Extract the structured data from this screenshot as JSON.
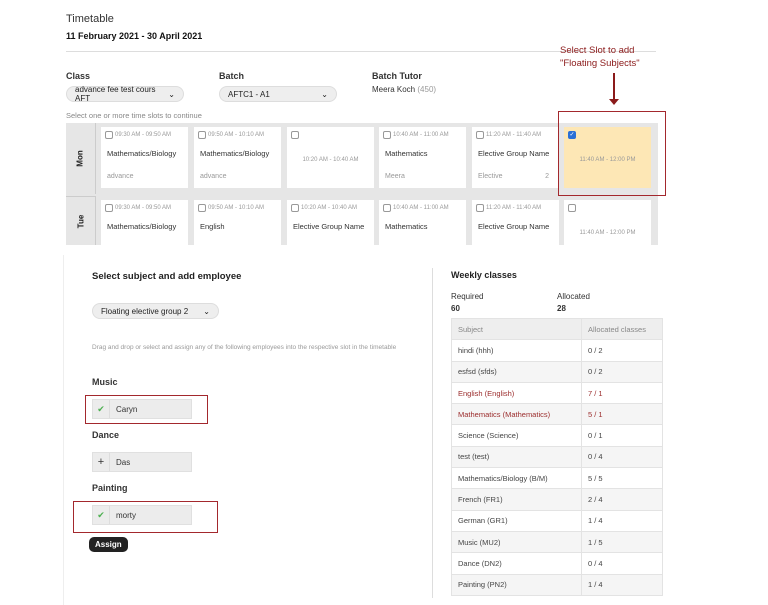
{
  "header": {
    "title": "Timetable",
    "dates": "11 February 2021 - 30 April 2021"
  },
  "filters": {
    "class_label": "Class",
    "class_value": "advance fee test cours AFT",
    "batch_label": "Batch",
    "batch_value": "AFTC1 - A1",
    "tutor_label": "Batch Tutor",
    "tutor_name": "Meera Koch",
    "tutor_count": "(450)",
    "hint": "Select one or more time slots to continue"
  },
  "annotation": {
    "line1": "Select Slot to add",
    "line2": "\"Floating Subjects\"",
    "color": "#8b1a1a"
  },
  "timetable": {
    "days": [
      {
        "day": "Mon",
        "slots": [
          {
            "time": "09:30 AM - 09:50 AM",
            "subject": "Mathematics/Biology",
            "employee": "advance",
            "checked": false
          },
          {
            "time": "09:50 AM - 10:10 AM",
            "subject": "Mathematics/Biology",
            "employee": "advance",
            "checked": false
          },
          {
            "time": "10:20 AM - 10:40 AM",
            "empty": true,
            "checked": false
          },
          {
            "time": "10:40 AM - 11:00 AM",
            "subject": "Mathematics",
            "employee": "Meera",
            "checked": false
          },
          {
            "time": "11:20 AM - 11:40 AM",
            "subject": "Elective Group Name",
            "employee": "Elective",
            "count": "2",
            "checked": false
          },
          {
            "time": "11:40 AM - 12:00 PM",
            "empty": true,
            "checked": true
          }
        ]
      },
      {
        "day": "Tue",
        "slots": [
          {
            "time": "09:30 AM - 09:50 AM",
            "subject": "Mathematics/Biology",
            "checked": false
          },
          {
            "time": "09:50 AM - 10:10 AM",
            "subject": "English",
            "checked": false
          },
          {
            "time": "10:20 AM - 10:40 AM",
            "subject": "Elective Group Name",
            "checked": false
          },
          {
            "time": "10:40 AM - 11:00 AM",
            "subject": "Mathematics",
            "checked": false
          },
          {
            "time": "11:20 AM - 11:40 AM",
            "subject": "Elective Group Name",
            "checked": false
          },
          {
            "time": "11:40 AM - 12:00 PM",
            "empty": true,
            "checked": false
          }
        ]
      }
    ]
  },
  "assign_panel": {
    "title": "Select subject and add employee",
    "group_value": "Floating elective group 2",
    "instructions": "Drag and drop or select and assign any of the following employees into the respective slot in the timetable",
    "groups": [
      {
        "subject": "Music",
        "employee": "Caryn",
        "icon": "check-icon"
      },
      {
        "subject": "Dance",
        "employee": "Das",
        "icon": "plus-icon"
      },
      {
        "subject": "Painting",
        "employee": "morty",
        "icon": "check-icon"
      }
    ],
    "assign_label": "Assign"
  },
  "weekly": {
    "title": "Weekly classes",
    "required_label": "Required",
    "required_value": "60",
    "allocated_label": "Allocated",
    "allocated_value": "28",
    "columns": [
      "Subject",
      "Allocated classes"
    ],
    "rows": [
      [
        "hindi (hhh)",
        "0 / 2"
      ],
      [
        "esfsd (sfds)",
        "0 / 2"
      ],
      [
        "English (English)",
        "7 / 1"
      ],
      [
        "Mathematics (Mathematics)",
        "5 / 1"
      ],
      [
        "Science (Science)",
        "0 / 1"
      ],
      [
        "test (test)",
        "0 / 4"
      ],
      [
        "Mathematics/Biology (B/M)",
        "5 / 5"
      ],
      [
        "French (FR1)",
        "2 / 4"
      ],
      [
        "German (GR1)",
        "1 / 4"
      ],
      [
        "Music (MU2)",
        "1 / 5"
      ],
      [
        "Dance (DN2)",
        "0 / 4"
      ],
      [
        "Painting (PN2)",
        "1 / 4"
      ]
    ],
    "over_allocated_rows": [
      2,
      3
    ]
  }
}
